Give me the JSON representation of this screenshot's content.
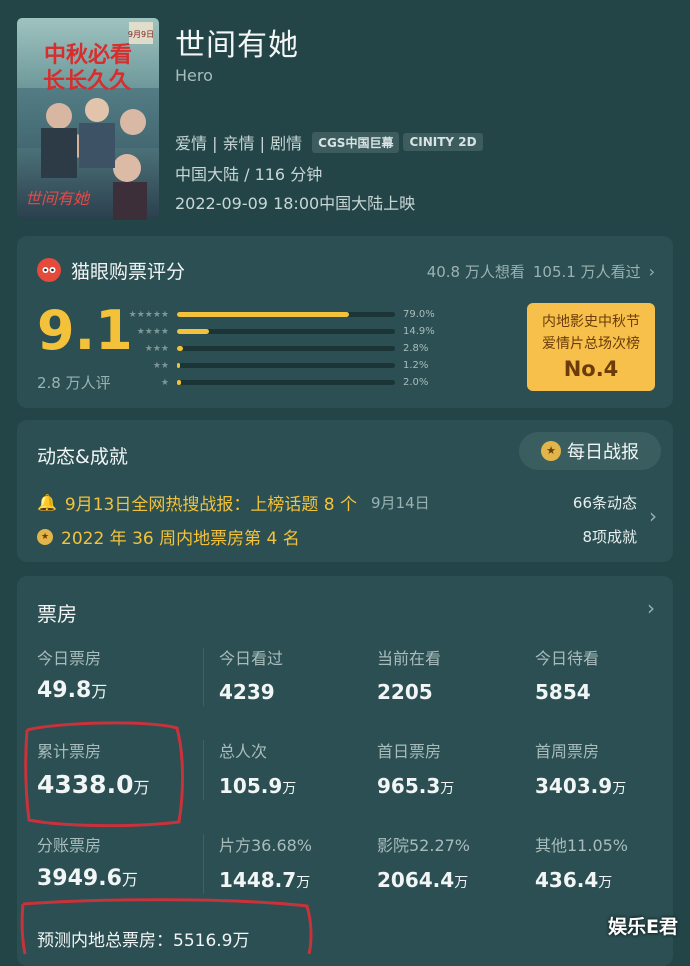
{
  "movie": {
    "title": "世间有她",
    "english_title": "Hero",
    "genres": "爱情 | 亲情 | 剧情",
    "tags": [
      "CGS中国巨幕",
      "CINITY 2D"
    ],
    "region_duration": "中国大陆 / 116 分钟",
    "release": "2022-09-09 18:00中国大陆上映",
    "poster": {
      "line1": "中秋必看",
      "line2": "长长久久",
      "date": "9月9日",
      "logo": "世间有她"
    }
  },
  "rating": {
    "header": "猫眼购票评分",
    "want_to_see": "40.8 万人想看",
    "watched": "105.1 万人看过",
    "score": "9.1",
    "raters": "2.8 万人评",
    "distribution": [
      {
        "stars": "★★★★★",
        "pct_label": "79.0%",
        "value": 79.0
      },
      {
        "stars": "★★★★",
        "pct_label": "14.9%",
        "value": 14.9
      },
      {
        "stars": "★★★",
        "pct_label": "2.8%",
        "value": 2.8
      },
      {
        "stars": "★★",
        "pct_label": "1.2%",
        "value": 1.2
      },
      {
        "stars": "★",
        "pct_label": "2.0%",
        "value": 2.0
      }
    ],
    "badge_line1": "内地影史中秋节",
    "badge_line2": "爱情片总场次榜",
    "badge_rank": "No.4"
  },
  "dynamics": {
    "header": "动态&成就",
    "daily_button": "每日战报",
    "item1": "9月13日全网热搜战报：上榜话题 8 个",
    "item1_date": "9月14日",
    "item2": "2022 年 36 周内地票房第 4 名",
    "count1": "66条动态",
    "count2": "8项成就"
  },
  "boxoffice": {
    "header": "票房",
    "row1": [
      {
        "label": "今日票房",
        "value": "49.8",
        "unit": "万"
      },
      {
        "label": "今日看过",
        "value": "4239",
        "unit": ""
      },
      {
        "label": "当前在看",
        "value": "2205",
        "unit": ""
      },
      {
        "label": "今日待看",
        "value": "5854",
        "unit": ""
      }
    ],
    "row2": [
      {
        "label": "累计票房",
        "value": "4338.0",
        "unit": "万"
      },
      {
        "label": "总人次",
        "value": "105.9",
        "unit": "万"
      },
      {
        "label": "首日票房",
        "value": "965.3",
        "unit": "万"
      },
      {
        "label": "首周票房",
        "value": "3403.9",
        "unit": "万"
      }
    ],
    "row3": [
      {
        "label": "分账票房",
        "value": "3949.6",
        "unit": "万"
      },
      {
        "label": "片方36.68%",
        "value": "1448.7",
        "unit": "万"
      },
      {
        "label": "影院52.27%",
        "value": "2064.4",
        "unit": "万"
      },
      {
        "label": "其他11.05%",
        "value": "436.4",
        "unit": "万"
      }
    ],
    "forecast": "预测内地总票房：5516.9万"
  },
  "watermark": "娱乐E君"
}
